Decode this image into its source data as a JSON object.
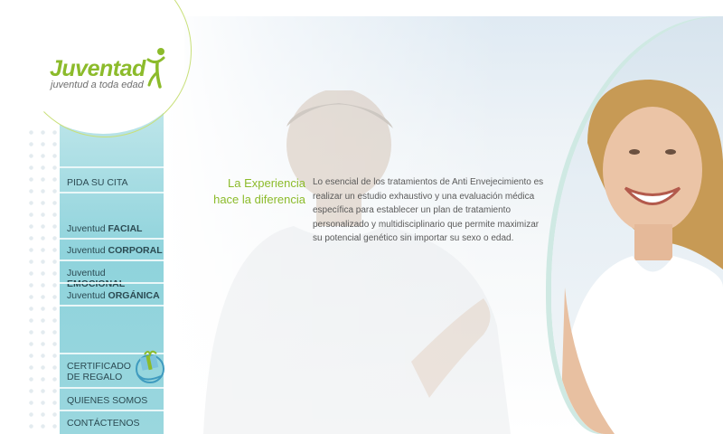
{
  "brand": {
    "title": "Juventad",
    "tagline": "juventud a toda edad",
    "accent_color": "#8cbb2b",
    "sidebar_color": "#9ad7de"
  },
  "nav": {
    "pida_cita": "PIDA SU CITA",
    "items": [
      {
        "prefix": "Juventud ",
        "emphasis": "FACIAL"
      },
      {
        "prefix": "Juventud ",
        "emphasis": "CORPORAL"
      },
      {
        "prefix": "Juventud ",
        "emphasis": "EMOCIONAL"
      },
      {
        "prefix": "Juventud ",
        "emphasis": "ORGÁNICA"
      }
    ],
    "certificado_line1": "CERTIFICADO",
    "certificado_line2": "DE REGALO",
    "quienes": "QUIENES SOMOS",
    "contactenos": "CONTÁCTENOS"
  },
  "hero": {
    "headline_line1": "La Experiencia",
    "headline_line2": "hace la diferencia",
    "body": "Lo esencial de los tratamientos de Anti Envejecimiento es realizar un estudio exhaustivo y una evaluación médica específica para establecer un plan de tratamiento personalizado y multidisciplinario que permite maximizar su potencial genético sin importar su sexo o edad."
  },
  "icons": {
    "logo_figure": "person-jumping-icon",
    "gift": "gift-box-icon"
  }
}
